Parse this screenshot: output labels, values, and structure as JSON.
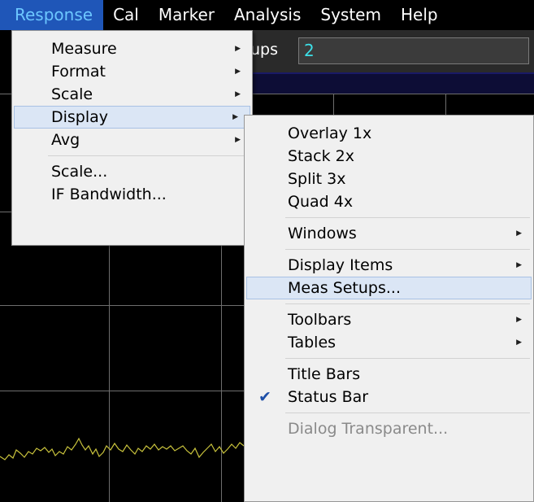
{
  "menubar": {
    "items": [
      {
        "label": "Response"
      },
      {
        "label": "Cal"
      },
      {
        "label": "Marker"
      },
      {
        "label": "Analysis"
      },
      {
        "label": "System"
      },
      {
        "label": "Help"
      }
    ]
  },
  "background": {
    "setups_label": "ups",
    "setups_value": "2"
  },
  "response_menu": {
    "items": [
      {
        "label": "Measure"
      },
      {
        "label": "Format"
      },
      {
        "label": "Scale"
      },
      {
        "label": "Display"
      },
      {
        "label": "Avg"
      },
      {
        "label": "Scale..."
      },
      {
        "label": "IF Bandwidth..."
      }
    ]
  },
  "display_submenu": {
    "items": [
      {
        "label": "Overlay 1x"
      },
      {
        "label": "Stack 2x"
      },
      {
        "label": "Split 3x"
      },
      {
        "label": "Quad 4x"
      },
      {
        "label": "Windows"
      },
      {
        "label": "Display Items"
      },
      {
        "label": "Meas Setups..."
      },
      {
        "label": "Toolbars"
      },
      {
        "label": "Tables"
      },
      {
        "label": "Title Bars"
      },
      {
        "label": "Status Bar",
        "checked": true
      },
      {
        "label": "Dialog Transparent...",
        "disabled": true
      }
    ]
  },
  "icons": {
    "submenu_arrow": "submenu-arrow-icon",
    "check": "checkmark-icon"
  },
  "colors": {
    "menubar_active_bg": "#1f56b8",
    "menubar_active_text": "#6cc7ff",
    "menu_bg": "#f0f0f0",
    "highlight_bg": "#dbe6f5",
    "trace": "#c8c23c",
    "setups_value": "#3ce0e8"
  }
}
